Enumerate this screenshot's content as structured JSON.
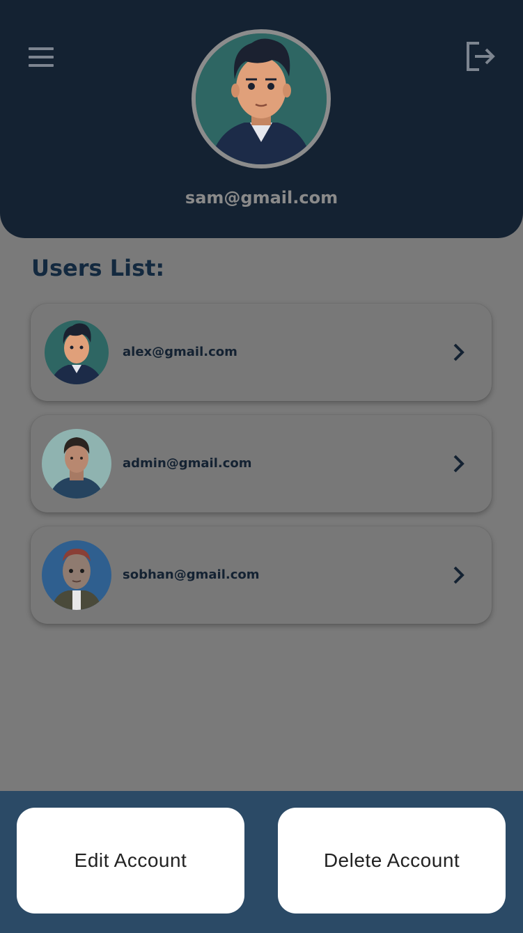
{
  "header": {
    "profile_email": "sam@gmail.com",
    "menu_icon": "hamburger-menu-icon",
    "logout_icon": "logout-icon"
  },
  "users_section": {
    "title": "Users List:",
    "users": [
      {
        "email": "alex@gmail.com",
        "avatar": "cartoon-man-avatar"
      },
      {
        "email": "admin@gmail.com",
        "avatar": "man-photo-avatar"
      },
      {
        "email": "sobhan@gmail.com",
        "avatar": "3d-character-avatar"
      }
    ]
  },
  "actions": {
    "edit_label": "Edit Account",
    "delete_label": "Delete Account"
  },
  "colors": {
    "header_bg": "#142232",
    "overlay_bg": "#7a7a7a",
    "bottom_bar_bg": "#2b4a66",
    "text_dark": "#13293f"
  }
}
